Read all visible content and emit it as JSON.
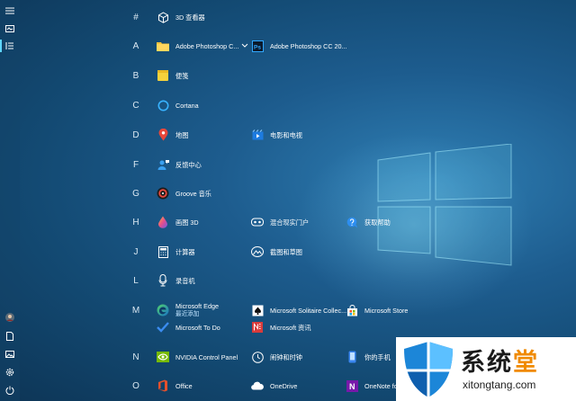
{
  "letters": {
    "hash": "#",
    "a": "A",
    "b": "B",
    "c": "C",
    "d": "D",
    "f": "F",
    "g": "G",
    "h": "H",
    "j": "J",
    "l": "L",
    "m": "M",
    "n": "N",
    "o": "O"
  },
  "apps": {
    "viewer3d": "3D 查看器",
    "photoshop_folder": "Adobe Photoshop C...",
    "photoshop_app": "Adobe Photoshop CC 20...",
    "sticky": "便笺",
    "cortana": "Cortana",
    "maps": "地图",
    "movies": "电影和电视",
    "feedback": "反馈中心",
    "groove": "Groove 音乐",
    "paint3d": "画图 3D",
    "mixed_reality": "混合现实门户",
    "get_help": "获取帮助",
    "calculator": "计算器",
    "snip": "截图和草图",
    "recorder": "录音机",
    "edge": "Microsoft Edge",
    "edge_sub": "最近添加",
    "solitaire": "Microsoft Solitaire Collec...",
    "store": "Microsoft Store",
    "todo": "Microsoft To Do",
    "news": "Microsoft 资讯",
    "nvidia": "NVIDIA Control Panel",
    "alarms": "闹钟和时钟",
    "your_phone": "你的手机",
    "office": "Office",
    "onedrive": "OneDrive",
    "onenote": "OneNote fo"
  },
  "watermark": {
    "title": "系统",
    "title_accent": "堂",
    "url": "xitongtang.com"
  },
  "icons": {
    "rail": [
      "hamburger-icon",
      "tiles-icon",
      "list-icon",
      "user-avatar-icon",
      "document-icon",
      "pictures-icon",
      "settings-icon",
      "power-icon"
    ]
  }
}
